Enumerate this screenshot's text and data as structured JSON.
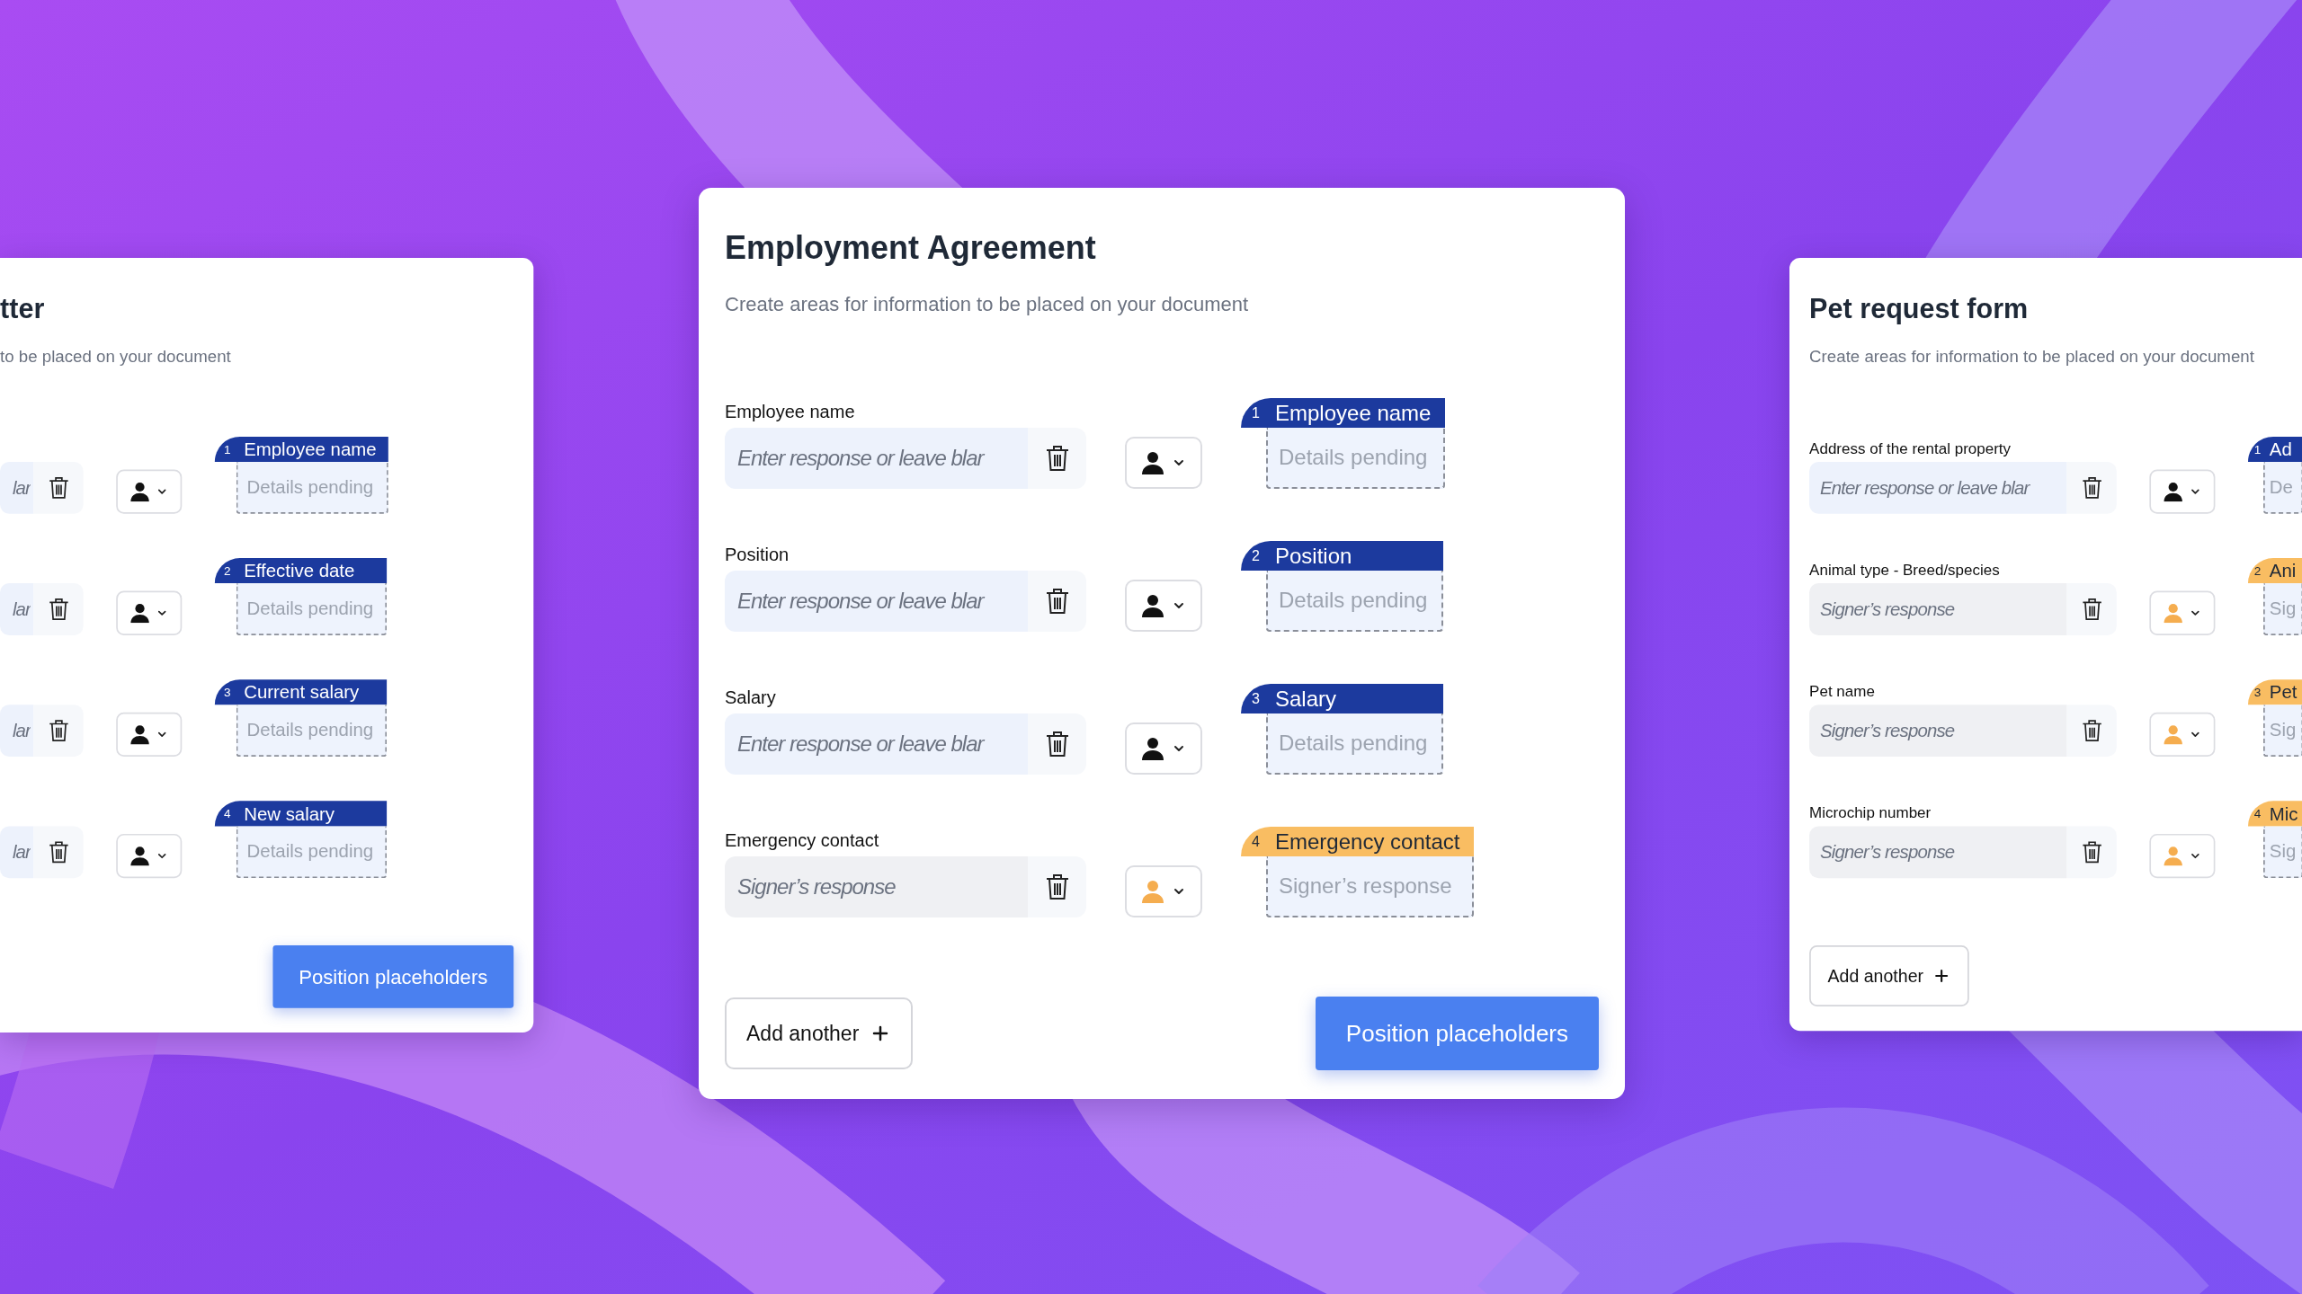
{
  "cards": [
    {
      "title": "tter",
      "subtitle": "to be placed on your document",
      "fields": [
        {
          "placeholder": "lar",
          "kind": "sender",
          "tag": {
            "number": "1",
            "label": "Employee name",
            "body": "Details pending"
          }
        },
        {
          "placeholder": "lar",
          "kind": "sender",
          "tag": {
            "number": "2",
            "label": "Effective date",
            "body": "Details pending"
          }
        },
        {
          "placeholder": "lar",
          "kind": "sender",
          "tag": {
            "number": "3",
            "label": "Current salary",
            "body": "Details pending"
          }
        },
        {
          "placeholder": "lar",
          "kind": "sender",
          "tag": {
            "number": "4",
            "label": "New salary",
            "body": "Details pending"
          }
        }
      ],
      "position_button": "Position placeholders"
    },
    {
      "title": "Employment Agreement",
      "subtitle": "Create areas for information to be placed on your document",
      "fields": [
        {
          "label": "Employee name",
          "placeholder": "Enter response or leave blar",
          "kind": "sender",
          "tag": {
            "number": "1",
            "label": "Employee name",
            "body": "Details pending"
          }
        },
        {
          "label": "Position",
          "placeholder": "Enter response or leave blar",
          "kind": "sender",
          "tag": {
            "number": "2",
            "label": "Position",
            "body": "Details pending"
          }
        },
        {
          "label": "Salary",
          "placeholder": "Enter response or leave blar",
          "kind": "sender",
          "tag": {
            "number": "3",
            "label": "Salary",
            "body": "Details pending"
          }
        },
        {
          "label": "Emergency contact",
          "placeholder": "Signer’s response",
          "kind": "signer",
          "tag": {
            "number": "4",
            "label": "Emergency contact",
            "body": "Signer’s response"
          }
        }
      ],
      "add_button": "Add another",
      "position_button": "Position placeholders"
    },
    {
      "title": "Pet request form",
      "subtitle": "Create areas for information to be placed on your document",
      "fields": [
        {
          "label": "Address of the rental property",
          "placeholder": "Enter response or leave blar",
          "kind": "sender",
          "tag": {
            "number": "1",
            "label": "Ad",
            "body": "De"
          }
        },
        {
          "label": "Animal type - Breed/species",
          "placeholder": "Signer’s response",
          "kind": "signer",
          "tag": {
            "number": "2",
            "label": "Ani",
            "body": "Sig"
          }
        },
        {
          "label": "Pet name",
          "placeholder": "Signer’s response",
          "kind": "signer",
          "tag": {
            "number": "3",
            "label": "Pet",
            "body": "Sig"
          }
        },
        {
          "label": "Microchip number",
          "placeholder": "Signer’s response",
          "kind": "signer",
          "tag": {
            "number": "4",
            "label": "Mic",
            "body": "Sig"
          }
        }
      ],
      "add_button": "Add another"
    }
  ]
}
